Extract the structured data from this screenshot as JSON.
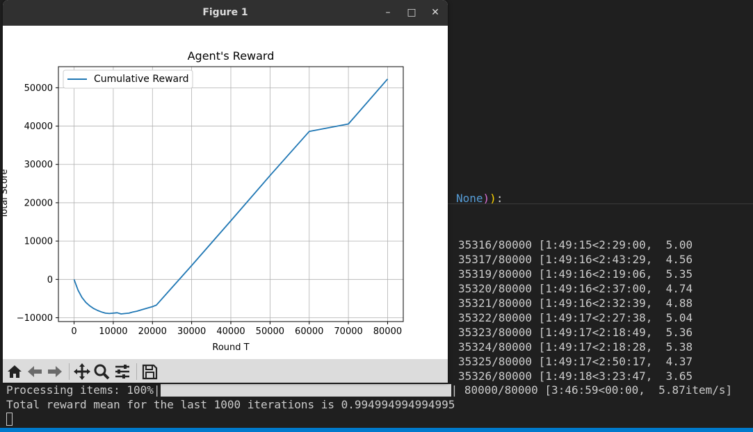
{
  "window": {
    "title": "Figure 1",
    "minimize_glyph": "–",
    "maximize_glyph": "□",
    "close_glyph": "✕"
  },
  "toolbar": {
    "icons": [
      "home-icon",
      "back-icon",
      "forward-icon",
      "pan-icon",
      "zoom-icon",
      "configure-subplots-icon",
      "save-icon"
    ]
  },
  "chart_data": {
    "type": "line",
    "title": "Agent's Reward",
    "xlabel": "Round T",
    "ylabel": "Total Score",
    "xlim": [
      -4000,
      84000
    ],
    "ylim": [
      -11000,
      55500
    ],
    "xticks": [
      0,
      10000,
      20000,
      30000,
      40000,
      50000,
      60000,
      70000,
      80000
    ],
    "xtick_labels": [
      "0",
      "10000",
      "20000",
      "30000",
      "40000",
      "50000",
      "60000",
      "70000",
      "80000"
    ],
    "yticks": [
      -10000,
      0,
      10000,
      20000,
      30000,
      40000,
      50000
    ],
    "ytick_labels": [
      "−10000",
      "0",
      "10000",
      "20000",
      "30000",
      "40000",
      "50000"
    ],
    "grid": true,
    "legend": "top-left",
    "series": [
      {
        "name": "Cumulative Reward",
        "color": "#1f77b4",
        "x": [
          0,
          1000,
          2000,
          3000,
          4000,
          5000,
          6000,
          7000,
          8000,
          9000,
          10000,
          11000,
          12000,
          13000,
          14000,
          15000,
          16000,
          17000,
          18000,
          19000,
          20000,
          21000,
          25000,
          30000,
          40000,
          50000,
          60000,
          70000,
          80000
        ],
        "y": [
          0,
          -2800,
          -4700,
          -6000,
          -6900,
          -7600,
          -8100,
          -8500,
          -8800,
          -8900,
          -8800,
          -8700,
          -9000,
          -8900,
          -8800,
          -8500,
          -8300,
          -8000,
          -7700,
          -7400,
          -7100,
          -6700,
          -2100,
          3600,
          15300,
          27100,
          38600,
          40550,
          52300
        ]
      }
    ]
  },
  "terminal": {
    "code_prefix": "None",
    "code_paren_inner": ")",
    "code_paren_outer": ")",
    "code_suffix": ":",
    "lines": [
      "35316/80000 [1:49:15<2:29:00,  5.00",
      "35317/80000 [1:49:16<2:43:29,  4.56",
      "35319/80000 [1:49:16<2:19:06,  5.35",
      "35320/80000 [1:49:16<2:37:00,  4.74",
      "35321/80000 [1:49:16<2:32:39,  4.88",
      "35322/80000 [1:49:17<2:27:38,  5.04",
      "35323/80000 [1:49:17<2:18:49,  5.36",
      "35324/80000 [1:49:17<2:18:28,  5.38",
      "35325/80000 [1:49:17<2:50:17,  4.37",
      "35326/80000 [1:49:18<3:23:47,  3.65"
    ],
    "progress_label": "Processing items: 100%|",
    "progress_fraction": 1.0,
    "progress_tail": "| 80000/80000 [3:46:59<00:00,  5.87item/s]",
    "summary_line": "Total reward mean for the last 1000 iterations is 0.994994994994995"
  }
}
